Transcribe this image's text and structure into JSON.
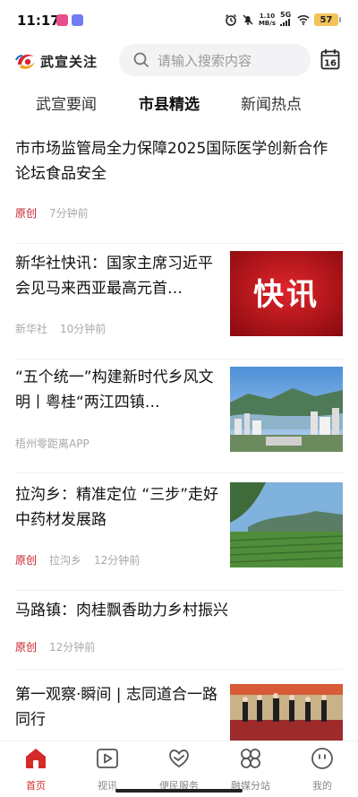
{
  "status_bar": {
    "time": "11:17",
    "net_speed_value": "1.10",
    "net_speed_unit": "MB/s",
    "network": "5G",
    "battery": "57"
  },
  "header": {
    "logo_text": "武宣关注",
    "search_placeholder": "请输入搜索内容",
    "calendar_day": "16"
  },
  "tabs": [
    {
      "label": "武宣要闻",
      "active": false
    },
    {
      "label": "市县精选",
      "active": true
    },
    {
      "label": "新闻热点",
      "active": false
    }
  ],
  "feed": [
    {
      "title": "市市场监管局全力保障2025国际医学创新合作论坛食品安全",
      "tag": "原创",
      "source": "",
      "time": "7分钟前",
      "image": ""
    },
    {
      "title": "新华社快讯：国家主席习近平会见马来西亚最高元首…",
      "tag": "",
      "source": "新华社",
      "time": "10分钟前",
      "image": "kuaixun",
      "image_text": "快讯"
    },
    {
      "title": "“五个统一”构建新时代乡风文明丨粤桂“两江四镇…",
      "tag": "",
      "source": "梧州零距离APP",
      "time": "",
      "image": "city-aerial"
    },
    {
      "title": "拉沟乡：精准定位 “三步”走好中药材发展路",
      "tag": "原创",
      "source": "拉沟乡",
      "time": "12分钟前",
      "image": "tea-field"
    },
    {
      "title": "马路镇：肉桂飘香助力乡村振兴",
      "tag": "原创",
      "source": "",
      "time": "12分钟前",
      "image": ""
    },
    {
      "title": "第一观察·瞬间 | 志同道合一路同行",
      "tag": "",
      "source": "",
      "time": "",
      "image": "ceremony"
    }
  ],
  "bottom_nav": [
    {
      "label": "首页",
      "icon": "home-icon",
      "active": true
    },
    {
      "label": "视讯",
      "icon": "video-icon",
      "active": false
    },
    {
      "label": "便民服务",
      "icon": "heart-hands-icon",
      "active": false
    },
    {
      "label": "融媒分站",
      "icon": "flower-grid-icon",
      "active": false
    },
    {
      "label": "我的",
      "icon": "smile-icon",
      "active": false
    }
  ],
  "colors": {
    "accent_red": "#d42b2b",
    "tag_red": "#c8202a"
  }
}
